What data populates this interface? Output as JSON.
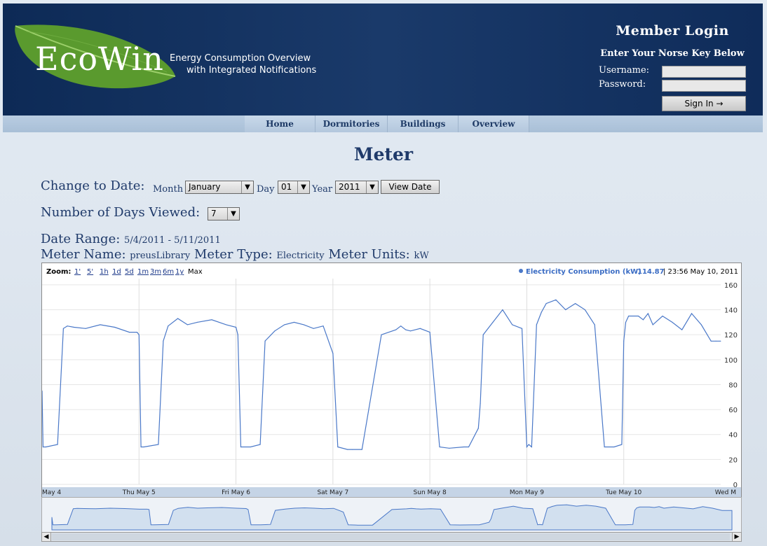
{
  "header": {
    "logo": "EcoWin",
    "tagline_line1": "Energy Consumption Overview",
    "tagline_line2": "with Integrated Notifications"
  },
  "login": {
    "title": "Member Login",
    "subtitle": "Enter Your Norse Key Below",
    "username_label": "Username:",
    "password_label": "Password:",
    "username_value": "",
    "password_value": "",
    "signin_label": "Sign In →"
  },
  "nav": [
    "Home",
    "Dormitories",
    "Buildings",
    "Overview"
  ],
  "page_title": "Meter",
  "controls": {
    "change_date_label": "Change to Date:",
    "month_label": "Month",
    "month_value": "January",
    "day_label": "Day",
    "day_value": "01",
    "year_label": "Year",
    "year_value": "2011",
    "view_date": "View Date",
    "days_viewed_label": "Number of Days Viewed:",
    "days_viewed_value": "7"
  },
  "info": {
    "date_range_label": "Date Range:",
    "date_range_value": "5/4/2011 - 5/11/2011",
    "meter_name_label": "Meter Name:",
    "meter_name_value": "preusLibrary",
    "meter_type_label": "Meter Type:",
    "meter_type_value": "Electricity",
    "meter_units_label": "Meter Units:",
    "meter_units_value": "kW"
  },
  "chart_data": {
    "type": "line",
    "zoom_label": "Zoom:",
    "zoom_options": [
      "1'",
      "5'",
      "1h",
      "1d",
      "5d",
      "1m",
      "3m",
      "6m",
      "1y",
      "Max"
    ],
    "legend_series": "Electricity Consumption (kW)",
    "legend_value": "114.87",
    "legend_time": "| 23:56 May 10, 2011",
    "x_labels": [
      "May 4",
      "Thu May 5",
      "Fri May 6",
      "Sat May 7",
      "Sun May 8",
      "Mon May 9",
      "Tue May 10",
      "Wed M"
    ],
    "y_ticks": [
      0,
      20,
      40,
      60,
      80,
      100,
      120,
      140,
      160
    ],
    "ylim": [
      0,
      165
    ],
    "xlim": [
      0,
      7
    ],
    "series_color": "#4a78c8",
    "x": [
      0,
      0.01,
      0.04,
      0.16,
      0.22,
      0.26,
      0.33,
      0.45,
      0.6,
      0.75,
      0.9,
      0.98,
      1.0,
      1.02,
      1.05,
      1.2,
      1.25,
      1.3,
      1.4,
      1.5,
      1.6,
      1.75,
      1.9,
      2.0,
      2.02,
      2.05,
      2.15,
      2.25,
      2.3,
      2.4,
      2.5,
      2.6,
      2.7,
      2.8,
      2.9,
      3.0,
      3.05,
      3.15,
      3.2,
      3.3,
      3.5,
      3.65,
      3.7,
      3.75,
      3.8,
      3.9,
      4.0,
      4.1,
      4.2,
      4.35,
      4.4,
      4.5,
      4.52,
      4.55,
      4.6,
      4.65,
      4.75,
      4.85,
      4.95,
      5.0,
      5.02,
      5.05,
      5.1,
      5.15,
      5.2,
      5.3,
      5.4,
      5.5,
      5.6,
      5.7,
      5.8,
      5.9,
      5.98,
      6.0,
      6.02,
      6.05,
      6.15,
      6.2,
      6.25,
      6.3,
      6.4,
      6.5,
      6.6,
      6.7,
      6.8,
      6.9,
      6.95,
      7.0
    ],
    "y": [
      75,
      30,
      30,
      32,
      125,
      127,
      126,
      125,
      128,
      126,
      122,
      122,
      120,
      30,
      30,
      32,
      115,
      127,
      133,
      128,
      130,
      132,
      128,
      126,
      120,
      30,
      30,
      32,
      115,
      123,
      128,
      130,
      128,
      125,
      127,
      105,
      30,
      28,
      28,
      28,
      120,
      124,
      127,
      124,
      123,
      125,
      122,
      30,
      29,
      30,
      30,
      45,
      65,
      120,
      125,
      130,
      140,
      128,
      125,
      30,
      32,
      30,
      128,
      138,
      145,
      148,
      140,
      145,
      140,
      128,
      30,
      30,
      32,
      115,
      130,
      135,
      135,
      132,
      137,
      128,
      135,
      130,
      124,
      137,
      128,
      114.87,
      114.87,
      114.87
    ]
  }
}
